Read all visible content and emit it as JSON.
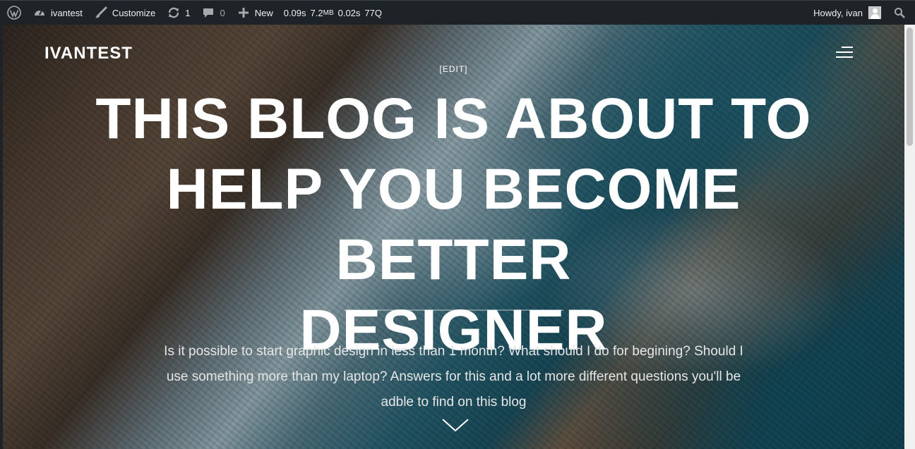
{
  "admin_bar": {
    "site_name": "ivantest",
    "customize": "Customize",
    "updates_count": "1",
    "comments_count": "0",
    "new_label": "New",
    "perf_time": "0.09s",
    "perf_mem_value": "7.2",
    "perf_mem_unit": "MB",
    "perf_query_time": "0.02s",
    "perf_queries": "77Q",
    "howdy": "Howdy, ivan"
  },
  "hero": {
    "site_title": "IVANTEST",
    "edit_link": "[EDIT]",
    "headline_lines": [
      "THIS BLOG IS ABOUT TO",
      "HELP YOU BECOME BETTER",
      "DESIGNER"
    ],
    "intro_lines": [
      "Is it possible to start graphic design in less than 1 month? What should I do for begining? Should I",
      "use something more than my laptop? Answers for this and a lot more different questions you'll be",
      "adble to find on this blog"
    ]
  },
  "colors": {
    "admin_bar_bg": "#1d2327",
    "admin_bar_text": "#f0f0f1",
    "hero_text": "#ffffff"
  },
  "icons": [
    "wordpress-icon",
    "dashboard-icon",
    "brush-icon",
    "updates-icon",
    "comment-icon",
    "plus-icon",
    "search-icon",
    "menu-icon",
    "chevron-down-icon"
  ]
}
